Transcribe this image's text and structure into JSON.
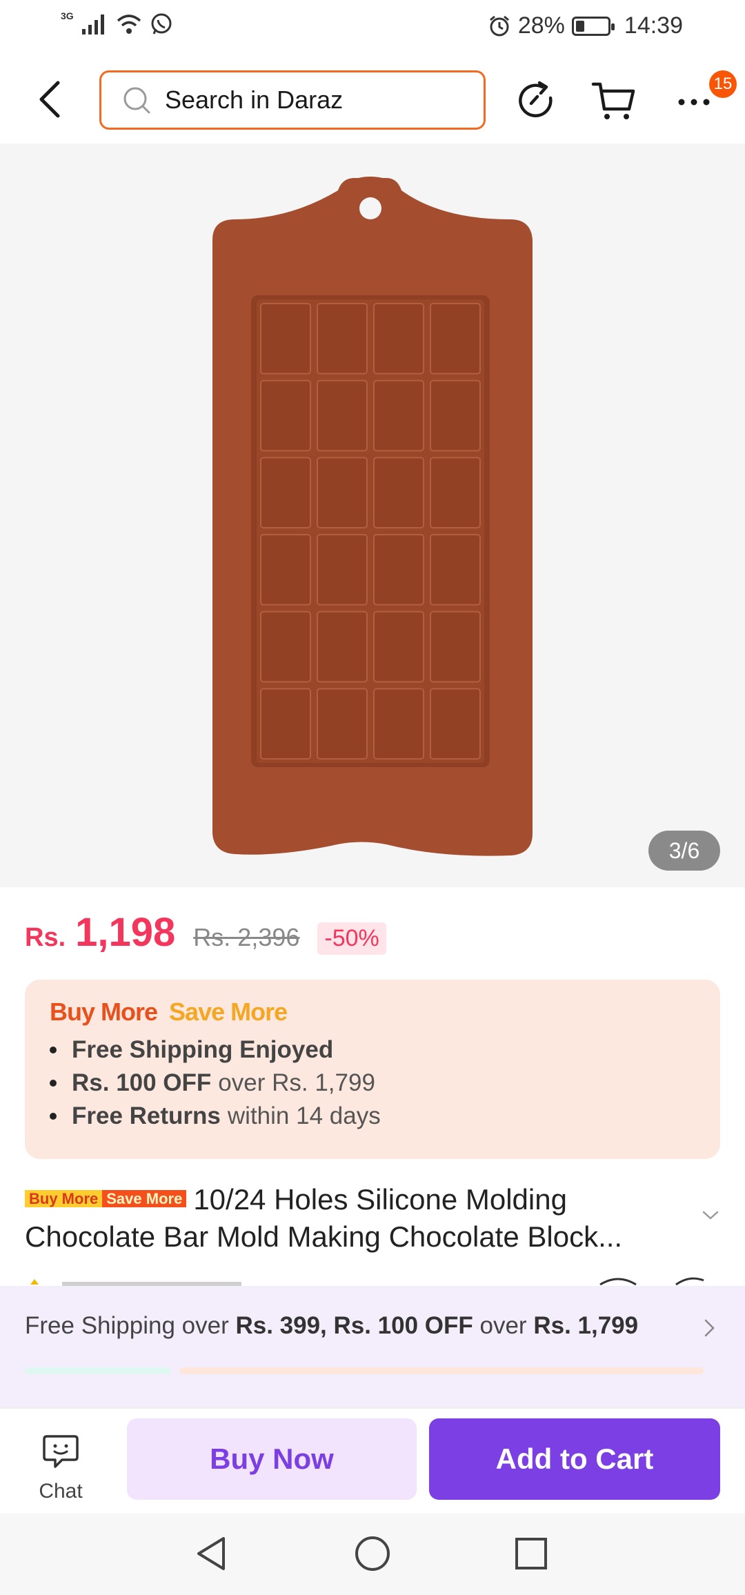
{
  "status_bar": {
    "network": "3G",
    "battery_percent": "28%",
    "battery_level": 0.28,
    "time": "14:39"
  },
  "header": {
    "search_placeholder": "Search in Daraz",
    "more_badge": "15"
  },
  "gallery": {
    "counter": "3/6"
  },
  "price": {
    "currency": "Rs.",
    "current": "1,198",
    "original": "Rs. 2,396",
    "discount": "-50%"
  },
  "promo": {
    "title_part1": "Buy More",
    "title_part2": "Save More",
    "items": [
      {
        "bold": "Free Shipping Enjoyed",
        "rest": ""
      },
      {
        "bold": "Rs. 100 OFF",
        "rest": "over Rs. 1,799"
      },
      {
        "bold": "Free Returns",
        "rest": "within 14 days"
      }
    ]
  },
  "product": {
    "tag_part1": "Buy More",
    "tag_part2": "Save More",
    "title": "10/24 Holes Silicone Molding Chocolate Bar Mold Making Chocolate Block..."
  },
  "shipping_banner": {
    "prefix": "Free Shipping over ",
    "bold1": "Rs. 399, Rs. 100 OFF",
    "middle": " over ",
    "bold2": "Rs. 1,799"
  },
  "actions": {
    "chat_label": "Chat",
    "buy_now": "Buy Now",
    "add_to_cart": "Add to Cart"
  },
  "colors": {
    "accent_orange": "#f26b21",
    "price_red": "#f5365c",
    "purple": "#7b3fe4",
    "mold_brown": "#a44e2f"
  },
  "icons": [
    "signal-icon",
    "wifi-icon",
    "whatsapp-icon",
    "alarm-icon",
    "battery-icon",
    "back-icon",
    "search-icon",
    "refresh-icon",
    "cart-icon",
    "more-icon",
    "chevron-down-icon",
    "chevron-right-icon",
    "chat-icon",
    "nav-back-icon",
    "nav-home-icon",
    "nav-recents-icon"
  ]
}
